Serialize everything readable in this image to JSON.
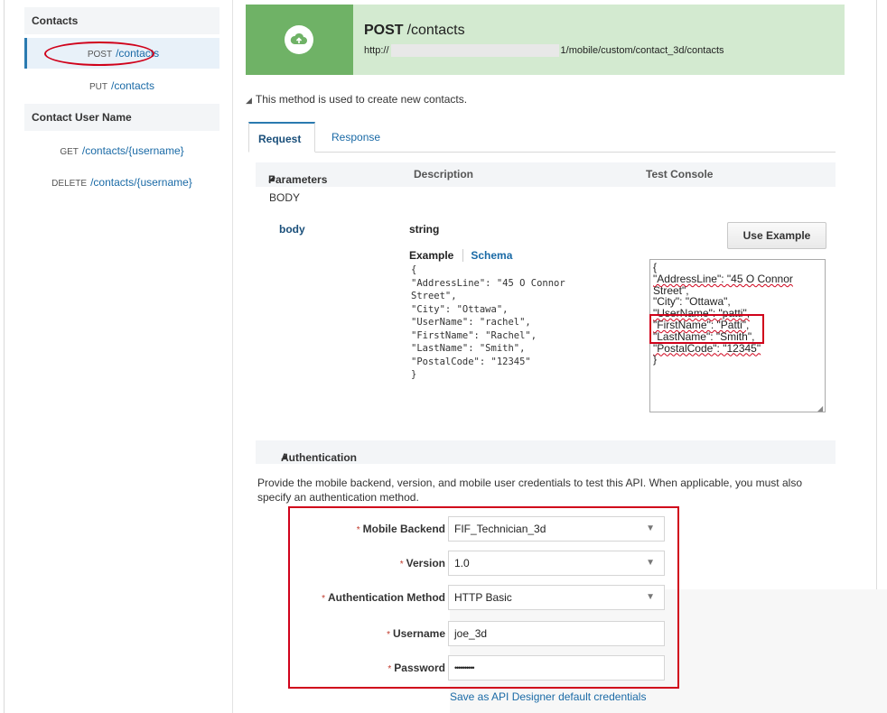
{
  "sidebar": {
    "sections": [
      {
        "label": "Contacts"
      },
      {
        "label": "Contact User Name"
      }
    ],
    "items": [
      {
        "verb": "POST",
        "path": "/contacts"
      },
      {
        "verb": "PUT",
        "path": "/contacts"
      },
      {
        "verb": "GET",
        "path": "/contacts/{username}"
      },
      {
        "verb": "DELETE",
        "path": "/contacts/{username}"
      }
    ]
  },
  "header": {
    "method": "POST",
    "path": "/contacts",
    "url_prefix": "http://",
    "url_suffix": "1/mobile/custom/contact_3d/contacts",
    "icon": "cloud-upload-icon",
    "color": "#6fb266"
  },
  "description": "This method is used to create new contacts.",
  "tabs": [
    {
      "label": "Request"
    },
    {
      "label": "Response"
    }
  ],
  "table": {
    "headers": {
      "parameters": "Parameters",
      "description": "Description",
      "test_console": "Test Console"
    },
    "section": "BODY",
    "param_name": "body",
    "param_type": "string",
    "example_tab": "Example",
    "schema_tab": "Schema",
    "example_code": "{\n\"AddressLine\": \"45 O Connor\nStreet\",\n\"City\": \"Ottawa\",\n\"UserName\": \"rachel\",\n\"FirstName\": \"Rachel\",\n\"LastName\": \"Smith\",\n\"PostalCode\": \"12345\"\n}",
    "use_example_label": "Use Example",
    "console_lines": [
      "{",
      "\"AddressLine\": \"45 O Connor",
      "Street\",",
      "\"City\": \"Ottawa\",",
      "\"UserName\": \"patti\",",
      "\"FirstName\": \"Patti\",",
      "\"LastName\": \"Smith\",",
      "\"PostalCode\": \"12345\"",
      "}"
    ]
  },
  "auth": {
    "title": "Authentication",
    "description": "Provide the mobile backend, version, and mobile user credentials to test this API. When applicable, you must also specify an authentication method.",
    "fields": [
      {
        "label": "Mobile Backend",
        "value": "FIF_Technician_3d",
        "dropdown": true
      },
      {
        "label": "Version",
        "value": "1.0",
        "dropdown": true
      },
      {
        "label": "Authentication Method",
        "value": "HTTP Basic",
        "dropdown": true
      },
      {
        "label": "Username",
        "value": "joe_3d",
        "dropdown": false
      },
      {
        "label": "Password",
        "value": "••••••••••",
        "dropdown": false
      }
    ],
    "save_link": "Save as API Designer default credentials"
  },
  "colors": {
    "accent": "#2a7ab0",
    "highlight": "#d0021b",
    "header_bg": "#d3ead0"
  }
}
